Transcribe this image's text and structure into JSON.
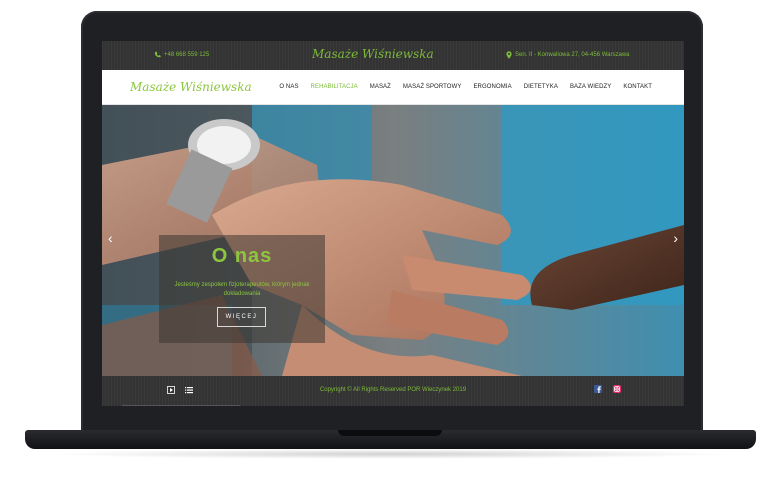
{
  "topbar": {
    "phone": "+48 668 559 125",
    "brand": "Masaże Wiśniewska",
    "address": "Sen. II - Konwaliowa 27, 04-456 Warszawa"
  },
  "navbar": {
    "logo": "Masaże Wiśniewska",
    "menu": [
      "O NAS",
      "REHABILITACJA",
      "MASAŻ",
      "MASAŻ SPORTOWY",
      "ERGONOMIA",
      "DIETETYKA",
      "BAZA WIEDZY",
      "KONTAKT"
    ],
    "active_index": 1
  },
  "hero": {
    "title": "O nas",
    "subtitle": "Jesteśmy zespołem fizjoterapeutów, którym jednak dokładowania",
    "button": "WIĘCEJ",
    "prev": "‹",
    "next": "›"
  },
  "footer": {
    "copyright": "Copyright © All Rights Reserved POR Wieczynek 2019"
  },
  "colors": {
    "accent": "#7dbb3a",
    "facebook": "#3b5998",
    "instagram": "#e1306c"
  },
  "icons": [
    "phone-icon",
    "map-pin-icon",
    "play-icon",
    "list-icon",
    "facebook-icon",
    "instagram-icon"
  ]
}
